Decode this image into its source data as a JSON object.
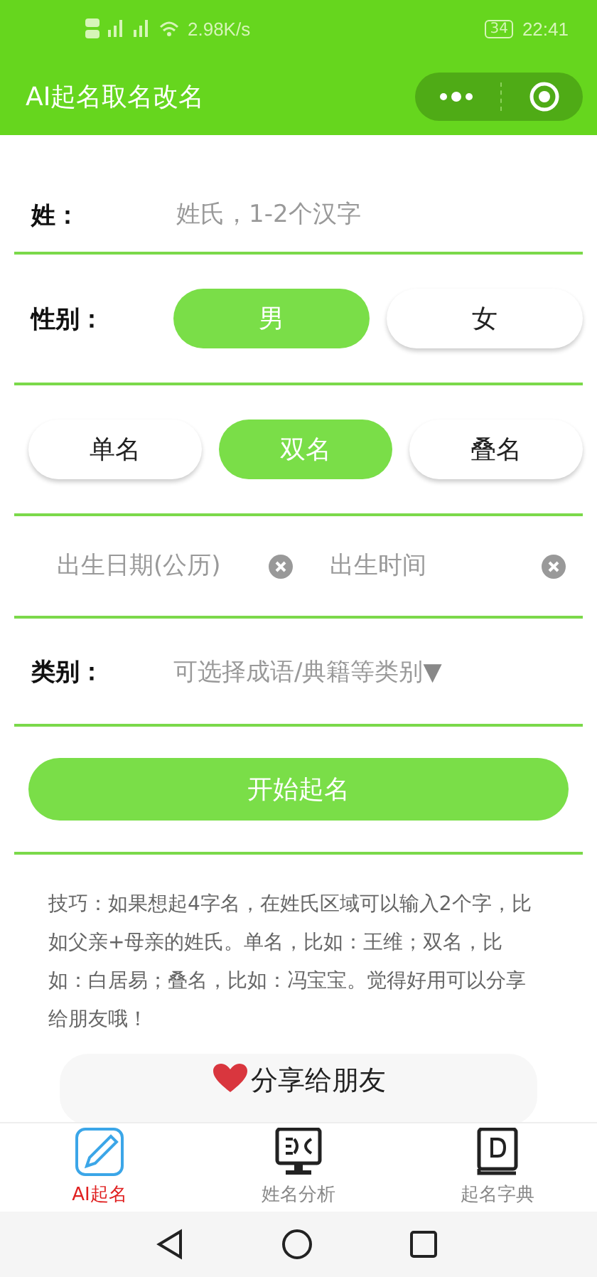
{
  "status_bar": {
    "speed": "2.98K/s",
    "battery": "34",
    "time": "22:41"
  },
  "header": {
    "title": "AI起名取名改名"
  },
  "surname": {
    "label": "姓：",
    "placeholder": "姓氏，1-2个汉字"
  },
  "gender": {
    "label": "性别：",
    "options": [
      {
        "label": "男",
        "selected": true
      },
      {
        "label": "女",
        "selected": false
      }
    ]
  },
  "name_type": {
    "options": [
      {
        "label": "单名",
        "selected": false
      },
      {
        "label": "双名",
        "selected": true
      },
      {
        "label": "叠名",
        "selected": false
      }
    ]
  },
  "birth": {
    "date_placeholder": "出生日期(公历)",
    "time_placeholder": "出生时间"
  },
  "category": {
    "label": "类别：",
    "placeholder": "可选择成语/典籍等类别",
    "arrow": "▼"
  },
  "start_button": "开始起名",
  "tips": "技巧：如果想起4字名，在姓氏区域可以输入2个字，比如父亲+母亲的姓氏。单名，比如：王维；双名，比如：白居易；叠名，比如：冯宝宝。觉得好用可以分享给朋友哦！",
  "share_button": "分享给朋友",
  "tabs": [
    {
      "label": "AI起名",
      "kind": "pencil",
      "selected": true
    },
    {
      "label": "姓名分析",
      "kind": "monitor",
      "selected": false
    },
    {
      "label": "起名字典",
      "kind": "book",
      "selected": false
    }
  ]
}
